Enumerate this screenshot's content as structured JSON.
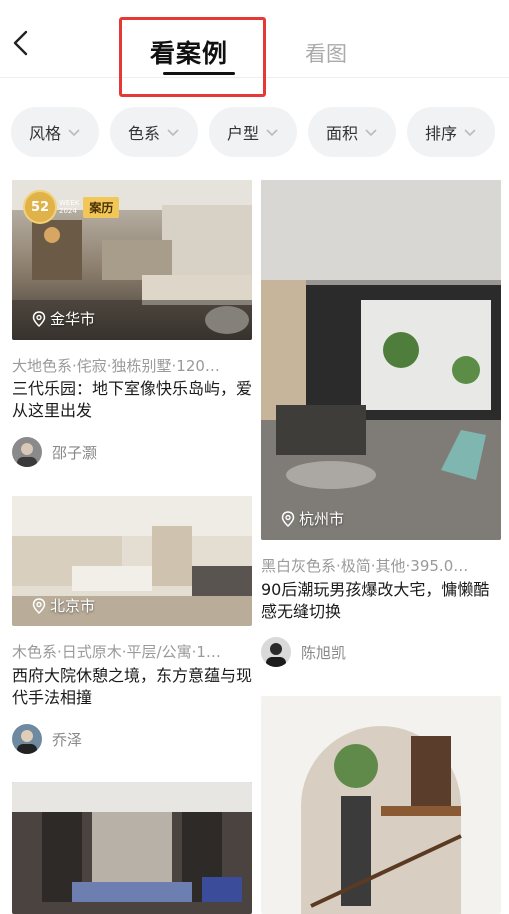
{
  "header": {
    "tab_active": "看案例",
    "tab_other": "看图"
  },
  "filters": [
    {
      "label": "风格"
    },
    {
      "label": "色系"
    },
    {
      "label": "户型"
    },
    {
      "label": "面积"
    },
    {
      "label": "排序"
    }
  ],
  "badge": {
    "number": "52",
    "week_line1": "WEEK",
    "week_line2": "2024",
    "tag": "案历"
  },
  "cards": [
    {
      "location": "金华市",
      "meta": "大地色系·侘寂·独栋别墅·120…",
      "title": "三代乐园：地下室像快乐岛屿，爱从这里出发",
      "author": "邵子灏"
    },
    {
      "location": "杭州市",
      "meta": "黑白灰色系·极简·其他·395.0…",
      "title": "90后潮玩男孩爆改大宅，慵懒酷感无缝切换",
      "author": "陈旭凯"
    },
    {
      "location": "北京市",
      "meta": "木色系·日式原木·平层/公寓·1…",
      "title": "西府大院休憩之境，东方意蕴与现代手法相撞",
      "author": "乔泽"
    }
  ],
  "colors": {
    "accent_red": "#e53935",
    "chip_bg": "#f1f2f4",
    "meta_gray": "#9a9a9a"
  }
}
